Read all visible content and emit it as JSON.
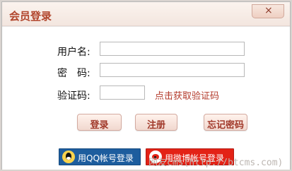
{
  "dialog": {
    "title": "会员登录",
    "close_label": "×"
  },
  "form": {
    "username_label": "用户名:",
    "password_label": "密　码:",
    "captcha_label": "验证码:",
    "captcha_link": "点击获取验证码",
    "username_value": "",
    "password_value": "",
    "captcha_value": ""
  },
  "buttons": {
    "login": "登录",
    "register": "注册",
    "forgot": "忘记密码"
  },
  "social": {
    "qq_label": "用QQ帐号登录",
    "weibo_label": "用微博帐号登录"
  },
  "watermark": "网友cms(http://btcms.com)"
}
